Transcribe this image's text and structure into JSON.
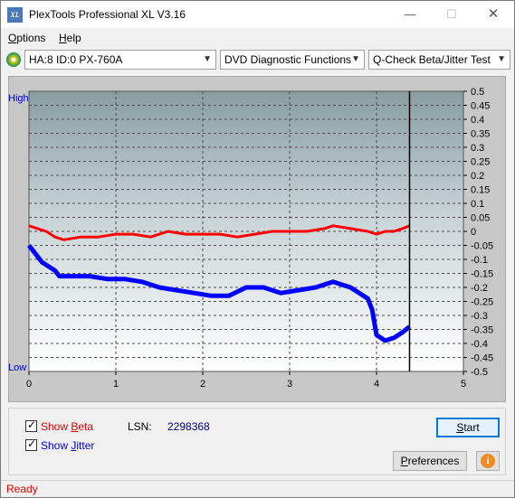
{
  "window": {
    "title": "PlexTools Professional XL V3.16",
    "app_icon_text": "XL",
    "minimize_glyph": "—",
    "maximize_glyph": "☐",
    "close_glyph": "✕"
  },
  "menu": {
    "options": {
      "first": "O",
      "rest": "ptions"
    },
    "help": {
      "first": "H",
      "rest": "elp"
    }
  },
  "toolbar": {
    "drive_icon": "disc-drive-icon",
    "drive_select": "HA:8 ID:0  PX-760A",
    "function_select": "DVD Diagnostic Functions",
    "test_select": "Q-Check Beta/Jitter Test"
  },
  "chart": {
    "high_label": "High",
    "low_label": "Low"
  },
  "chart_data": {
    "type": "line",
    "x_range": [
      0,
      5
    ],
    "y_range": [
      -0.5,
      0.5
    ],
    "x_ticks": [
      "0",
      "1",
      "2",
      "3",
      "4",
      "5"
    ],
    "y_ticks": [
      "0.5",
      "0.45",
      "0.4",
      "0.35",
      "0.3",
      "0.25",
      "0.2",
      "0.15",
      "0.1",
      "0.05",
      "0",
      "-0.05",
      "-0.1",
      "-0.15",
      "-0.2",
      "-0.25",
      "-0.3",
      "-0.35",
      "-0.4",
      "-0.45",
      "-0.5"
    ],
    "grid": true,
    "end_marker_x": 4.38,
    "series": [
      {
        "color": "#ff0000",
        "x": [
          0.0,
          0.1,
          0.2,
          0.3,
          0.4,
          0.6,
          0.8,
          1.0,
          1.2,
          1.4,
          1.6,
          1.8,
          2.0,
          2.2,
          2.4,
          2.6,
          2.8,
          3.0,
          3.2,
          3.4,
          3.5,
          3.7,
          3.9,
          4.0,
          4.1,
          4.2,
          4.3,
          4.38
        ],
        "y": [
          0.02,
          0.01,
          0.0,
          -0.02,
          -0.03,
          -0.02,
          -0.02,
          -0.01,
          -0.01,
          -0.02,
          0.0,
          -0.01,
          -0.01,
          -0.01,
          -0.02,
          -0.01,
          0.0,
          0.0,
          0.0,
          0.01,
          0.02,
          0.01,
          0.0,
          -0.01,
          0.0,
          0.0,
          0.01,
          0.02
        ]
      },
      {
        "color": "#0000ff",
        "x": [
          0.0,
          0.05,
          0.1,
          0.15,
          0.2,
          0.25,
          0.3,
          0.35,
          0.5,
          0.7,
          0.9,
          1.1,
          1.3,
          1.5,
          1.7,
          1.9,
          2.1,
          2.3,
          2.5,
          2.7,
          2.9,
          3.1,
          3.3,
          3.5,
          3.7,
          3.9,
          3.95,
          4.0,
          4.1,
          4.2,
          4.3,
          4.38
        ],
        "y": [
          -0.05,
          -0.07,
          -0.09,
          -0.11,
          -0.12,
          -0.13,
          -0.14,
          -0.16,
          -0.16,
          -0.16,
          -0.17,
          -0.17,
          -0.18,
          -0.2,
          -0.21,
          -0.22,
          -0.23,
          -0.23,
          -0.2,
          -0.2,
          -0.22,
          -0.21,
          -0.2,
          -0.18,
          -0.2,
          -0.24,
          -0.28,
          -0.37,
          -0.39,
          -0.38,
          -0.36,
          -0.34
        ]
      }
    ]
  },
  "bottom": {
    "show_beta_prefix": "Show ",
    "show_beta_ul": "B",
    "show_beta_rest": "eta",
    "show_jitter_prefix": "Show ",
    "show_jitter_ul": "J",
    "show_jitter_rest": "itter",
    "lsn_label": "LSN:",
    "lsn_value": "2298368",
    "start_first": "S",
    "start_rest": "tart",
    "preferences_first": "P",
    "preferences_rest": "references",
    "info_glyph": "i",
    "beta_color": "#e00000",
    "jitter_color": "#0000e0"
  },
  "status": {
    "text": "Ready"
  }
}
